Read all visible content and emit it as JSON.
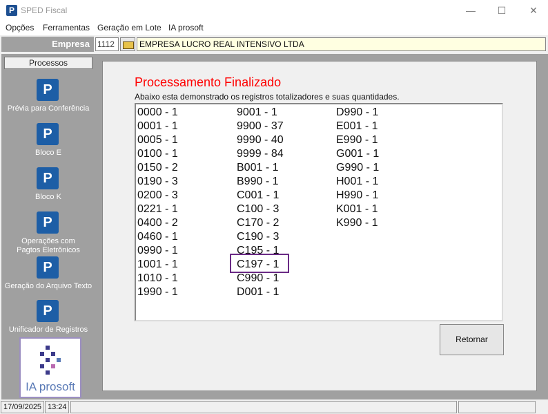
{
  "window": {
    "title": "SPED Fiscal",
    "app_icon": "P",
    "minimize_glyph": "—",
    "maximize_glyph": "☐",
    "close_glyph": "✕"
  },
  "menu": [
    "Opções",
    "Ferramentas",
    "Geração em Lote",
    "IA prosoft"
  ],
  "empresa": {
    "label": "Empresa",
    "code": "1112",
    "name": "EMPRESA LUCRO REAL INTENSIVO LTDA"
  },
  "sidebar": {
    "header": "Processos",
    "items": [
      {
        "label": "Prévia para Conferência",
        "icon": "prosoft-p-icon"
      },
      {
        "label": "Bloco E",
        "icon": "prosoft-p-icon"
      },
      {
        "label": "Bloco K",
        "icon": "prosoft-p-icon"
      },
      {
        "label": "Operações com\nPagtos Eletrônicos",
        "icon": "prosoft-p-icon"
      },
      {
        "label": "Geração do Arquivo Texto",
        "icon": "prosoft-p-icon"
      },
      {
        "label": "Unificador de Registros",
        "icon": "prosoft-p-icon"
      }
    ],
    "logo_text": "IA prosoft"
  },
  "content": {
    "title": "Processamento Finalizado",
    "subtitle": "Abaixo esta demonstrado os registros totalizadores e suas quantidades.",
    "columns": [
      [
        "0000 - 1",
        "0001 - 1",
        "0005 - 1",
        "0100 - 1",
        "0150 - 2",
        "0190 - 3",
        "0200 - 3",
        "0221 - 1",
        "0400 - 2",
        "0460 - 1",
        "0990 - 1",
        "1001 - 1",
        "1010 - 1",
        "1990 - 1"
      ],
      [
        "9001 - 1",
        "9900 - 37",
        "9990 - 40",
        "9999 - 84",
        "B001 - 1",
        "B990 - 1",
        "C001 - 1",
        "C100 - 3",
        "C170 - 2",
        "C190 - 3",
        "C195 - 1",
        "C197 - 1",
        "C990 - 1",
        "D001 - 1"
      ],
      [
        "D990 - 1",
        "E001 - 1",
        "E990 - 1",
        "G001 - 1",
        "G990 - 1",
        "H001 - 1",
        "H990 - 1",
        "K001 - 1",
        "K990 - 1"
      ]
    ],
    "highlight_color": "#6a2a85",
    "title_color": "#ff0000",
    "button_label": "Retornar"
  },
  "statusbar": {
    "date": "17/09/2025",
    "time": "13:24"
  }
}
